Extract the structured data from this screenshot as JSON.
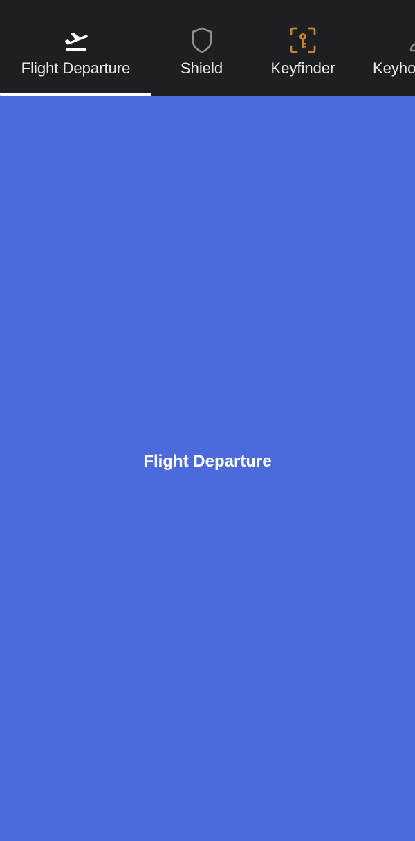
{
  "tabbar": {
    "tabs": [
      {
        "label": "Flight Departure",
        "icon": "flight-departure-icon",
        "active": true
      },
      {
        "label": "Shield",
        "icon": "shield-icon",
        "active": false
      },
      {
        "label": "Keyfinder",
        "icon": "keyfinder-icon",
        "active": false
      },
      {
        "label": "Keyho",
        "icon": "person-icon",
        "active": false
      }
    ]
  },
  "content": {
    "title": "Flight Departure"
  },
  "colors": {
    "tabbar_background": "#1e1f23",
    "content_background": "#4b6bdd",
    "indicator": "#ffffff",
    "keyfinder_icon": "#c9852a",
    "inactive_icon": "#8e8e93"
  }
}
